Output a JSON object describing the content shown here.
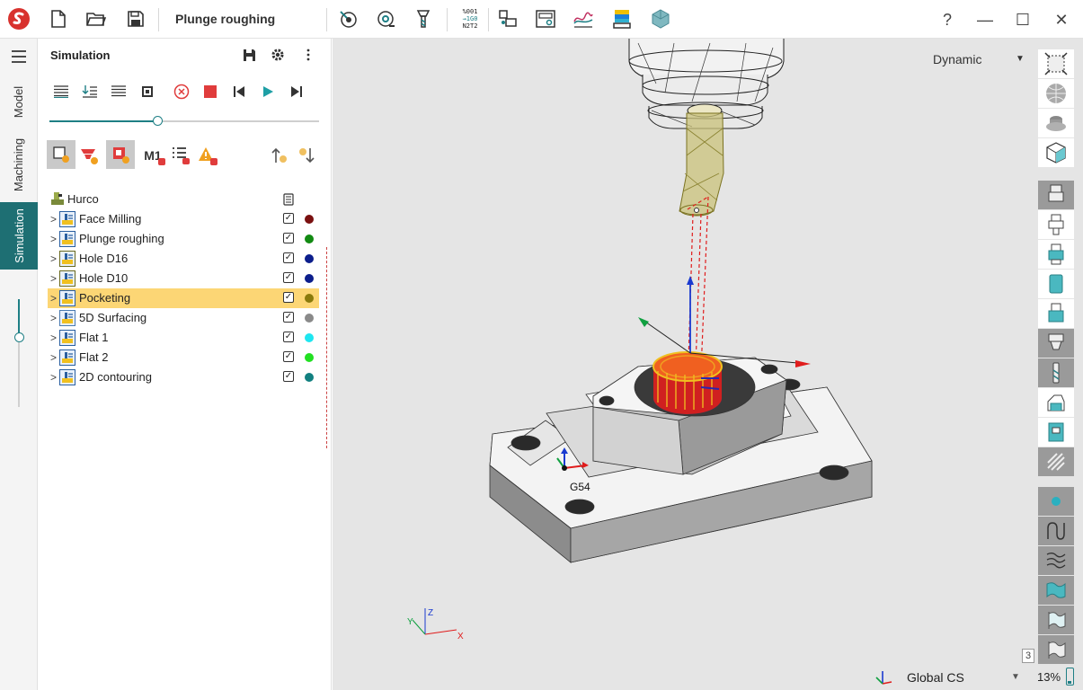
{
  "toolbar": {
    "doc_title": "Plunge roughing",
    "window_buttons": {
      "help": "?",
      "minimize": "—",
      "maximize": "☐",
      "close": "✕"
    },
    "nc_icon_lines": [
      "%001",
      "→1G0",
      "N2T2"
    ]
  },
  "vtabs": [
    {
      "label": "Model"
    },
    {
      "label": "Machining"
    },
    {
      "label": "Simulation"
    }
  ],
  "panel": {
    "title": "Simulation",
    "slider_fraction": 0.4,
    "machine": "Hurco",
    "m1_label": "M1",
    "operations": [
      {
        "label": "Face Milling",
        "color": "#7a1010",
        "checked": true,
        "selected": false
      },
      {
        "label": "Plunge roughing",
        "color": "#128a12",
        "checked": true,
        "selected": false
      },
      {
        "label": "Hole D16",
        "color": "#0c1e8c",
        "checked": true,
        "selected": false
      },
      {
        "label": "Hole D10",
        "color": "#0c1e8c",
        "checked": true,
        "selected": false
      },
      {
        "label": "Pocketing",
        "color": "#8a7a0c",
        "checked": true,
        "selected": true
      },
      {
        "label": "5D Surfacing",
        "color": "#8a8a8a",
        "checked": true,
        "selected": false
      },
      {
        "label": "Flat 1",
        "color": "#1ee6f0",
        "checked": true,
        "selected": false
      },
      {
        "label": "Flat 2",
        "color": "#22e022",
        "checked": true,
        "selected": false
      },
      {
        "label": "2D contouring",
        "color": "#128080",
        "checked": true,
        "selected": false
      }
    ]
  },
  "viewport": {
    "view_mode": "Dynamic",
    "coord_system": "Global CS",
    "zoom": "13%",
    "work_offset": "G54",
    "axis_labels": {
      "x": "X",
      "y": "Y",
      "z": "Z"
    },
    "badge": "3"
  },
  "colors": {
    "accent": "#1e6f73",
    "selection": "#fcd675",
    "logo": "#d8322e"
  }
}
